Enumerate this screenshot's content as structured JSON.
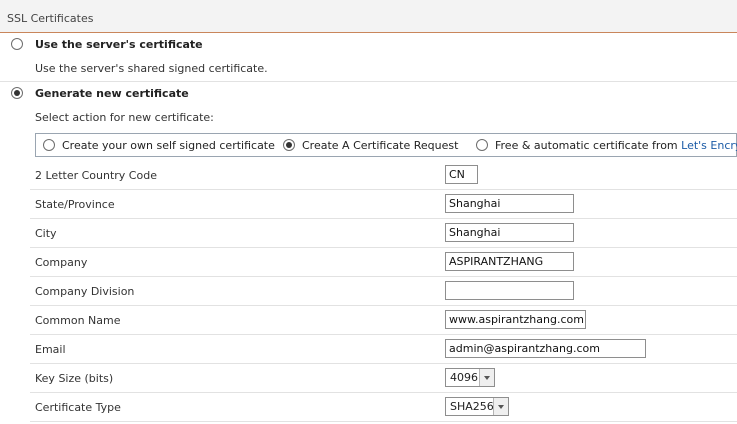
{
  "section": {
    "title": "SSL Certificates"
  },
  "options": {
    "server_cert": {
      "title": "Use the server's certificate",
      "description": "Use the server's shared signed certificate.",
      "selected": false
    },
    "generate_new": {
      "title": "Generate new certificate",
      "description": "Select action for new certificate:",
      "selected": true
    }
  },
  "actions": {
    "self_signed": {
      "label": "Create your own self signed certificate",
      "selected": false
    },
    "cert_request": {
      "label": "Create A Certificate Request",
      "selected": true
    },
    "lets_encrypt": {
      "label": "Free & automatic certificate from ",
      "link": "Let's Encrypt",
      "selected": false
    }
  },
  "form": {
    "country": {
      "label": "2 Letter Country Code",
      "value": "CN"
    },
    "state": {
      "label": "State/Province",
      "value": "Shanghai"
    },
    "city": {
      "label": "City",
      "value": "Shanghai"
    },
    "company": {
      "label": "Company",
      "value": "ASPIRANTZHANG"
    },
    "division": {
      "label": "Company Division",
      "value": ""
    },
    "common_name": {
      "label": "Common Name",
      "value": "www.aspirantzhang.com"
    },
    "email": {
      "label": "Email",
      "value": "admin@aspirantzhang.com"
    },
    "key_size": {
      "label": "Key Size (bits)",
      "value": "4096"
    },
    "cert_type": {
      "label": "Certificate Type",
      "value": "SHA256"
    }
  }
}
